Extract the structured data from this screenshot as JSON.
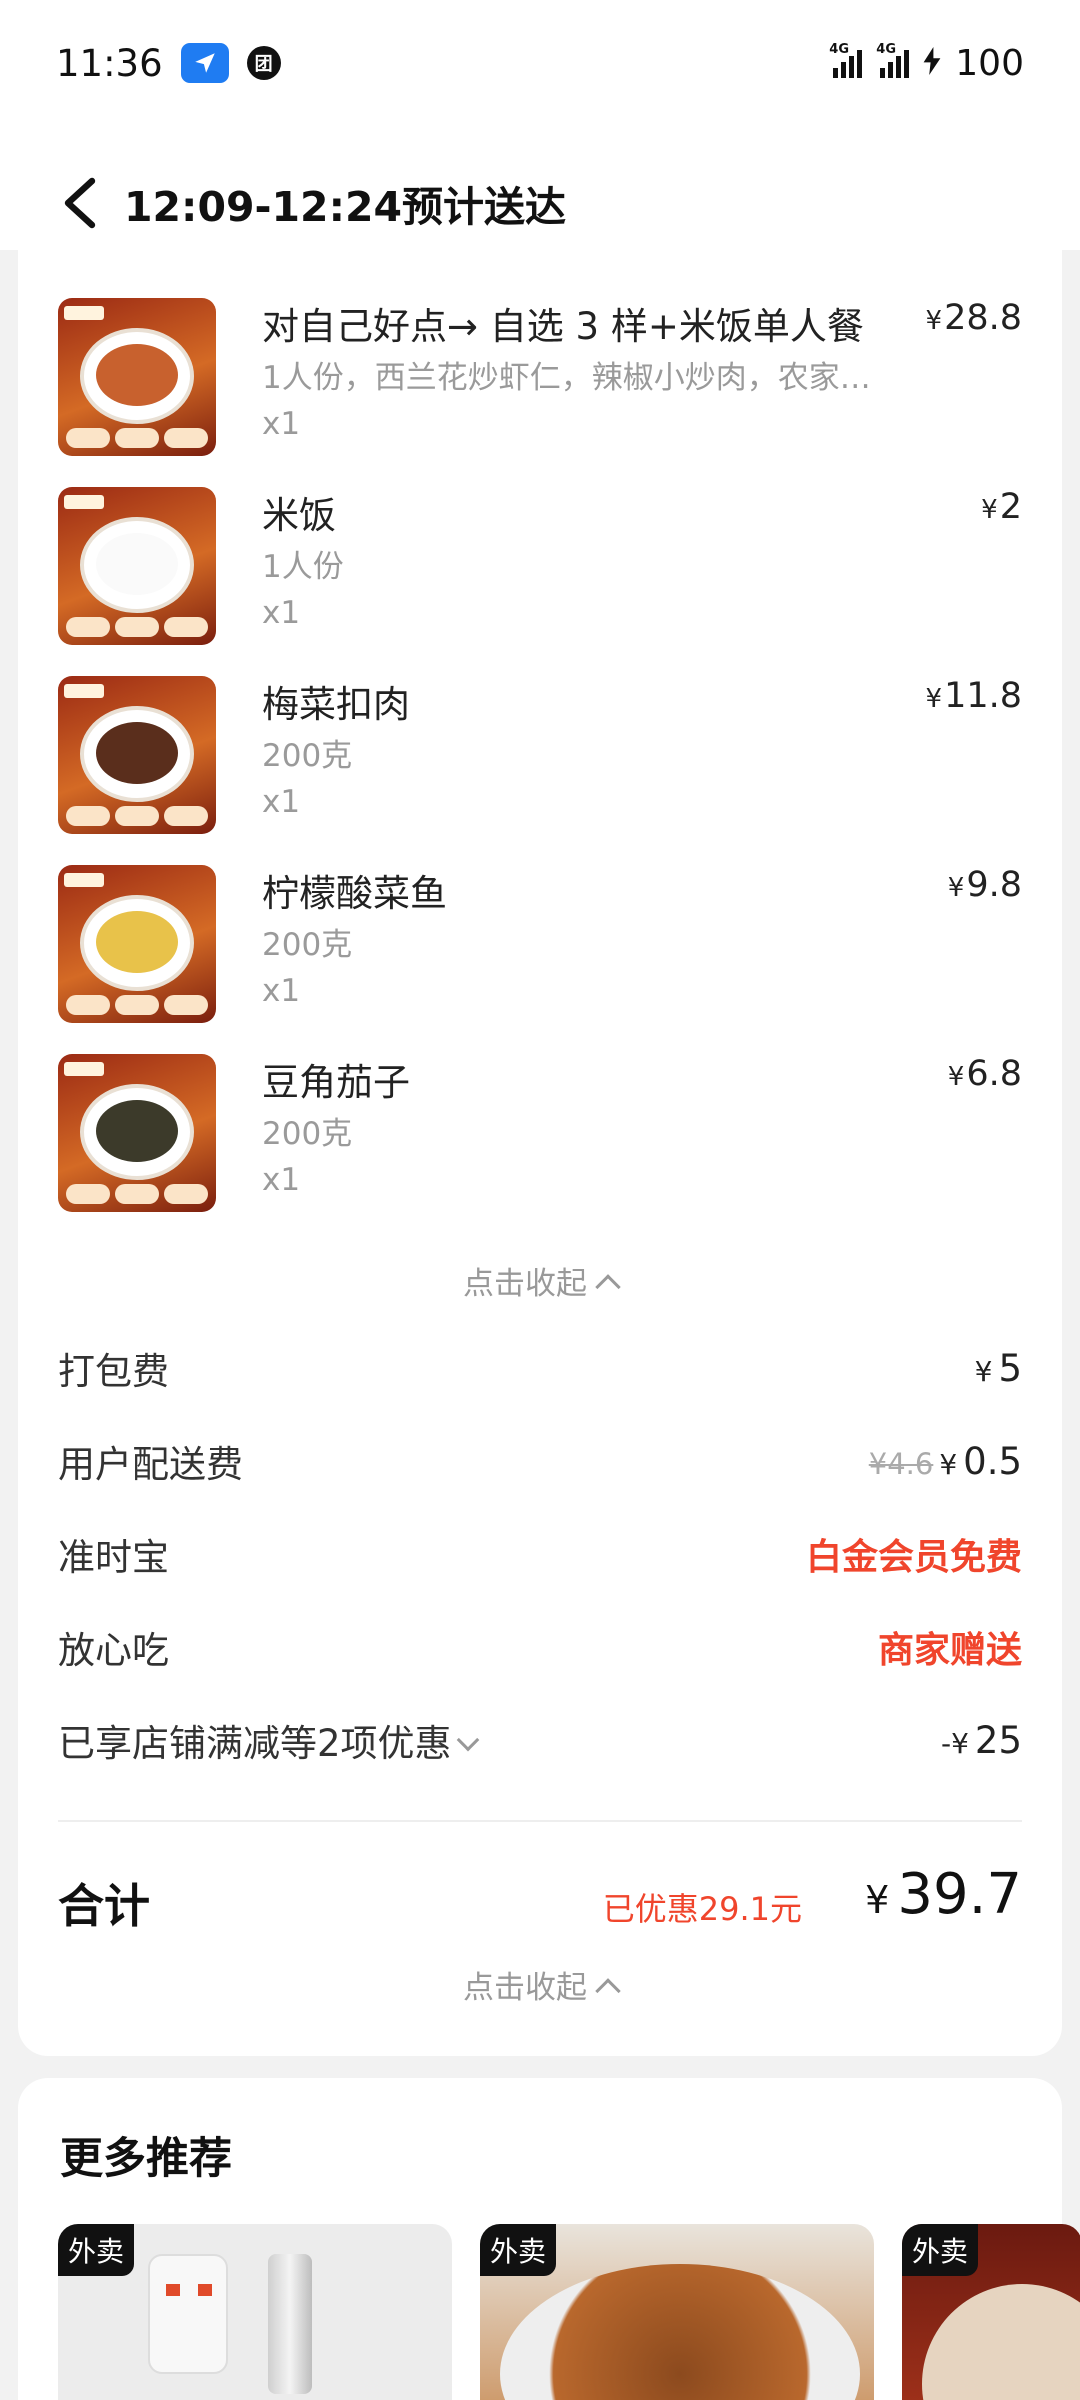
{
  "status_bar": {
    "time": "11:36",
    "sim1": "4G",
    "sim2": "4G",
    "battery": "100",
    "icons": [
      "navigation-icon",
      "tuan-app-icon",
      "signal-icon",
      "signal-icon",
      "charging-icon"
    ]
  },
  "header": {
    "title": "12:09-12:24预计送达",
    "back_icon": "chevron-left-icon"
  },
  "items": [
    {
      "name": "对自己好点→ 自选 3 样+米饭单人餐",
      "desc": "1人份，西兰花炒虾仁，辣椒小炒肉，农家…",
      "qty": "x1",
      "price": "28.8",
      "currency": "¥",
      "food_color": "#c8612e"
    },
    {
      "name": "米饭",
      "desc": "1人份",
      "qty": "x1",
      "price": "2",
      "currency": "¥",
      "food_color": "#ffffff"
    },
    {
      "name": "梅菜扣肉",
      "desc": "200克",
      "qty": "x1",
      "price": "11.8",
      "currency": "¥",
      "food_color": "#5a2e1c"
    },
    {
      "name": "柠檬酸菜鱼",
      "desc": "200克",
      "qty": "x1",
      "price": "9.8",
      "currency": "¥",
      "food_color": "#e8c24a"
    },
    {
      "name": "豆角茄子",
      "desc": "200克",
      "qty": "x1",
      "price": "6.8",
      "currency": "¥",
      "food_color": "#3c3a2a"
    }
  ],
  "collapse_label": "点击收起",
  "fees": {
    "packing": {
      "label": "打包费",
      "currency": "¥",
      "value": "5"
    },
    "delivery": {
      "label": "用户配送费",
      "original": "¥4.6",
      "currency": "¥",
      "value": "0.5"
    },
    "ontime": {
      "label": "准时宝",
      "value": "白金会员免费"
    },
    "assurance": {
      "label": "放心吃",
      "value": "商家赠送"
    },
    "discounts": {
      "label": "已享店铺满减等2项优惠",
      "prefix": "-¥",
      "value": "25"
    }
  },
  "total": {
    "label": "合计",
    "saved": "已优惠29.1元",
    "currency": "¥",
    "value": "39.7"
  },
  "more": {
    "title": "更多推荐",
    "tag": "外卖",
    "cards": 3
  },
  "colors": {
    "accent_red": "#f0452c",
    "nav_blue": "#1f7cf2"
  }
}
